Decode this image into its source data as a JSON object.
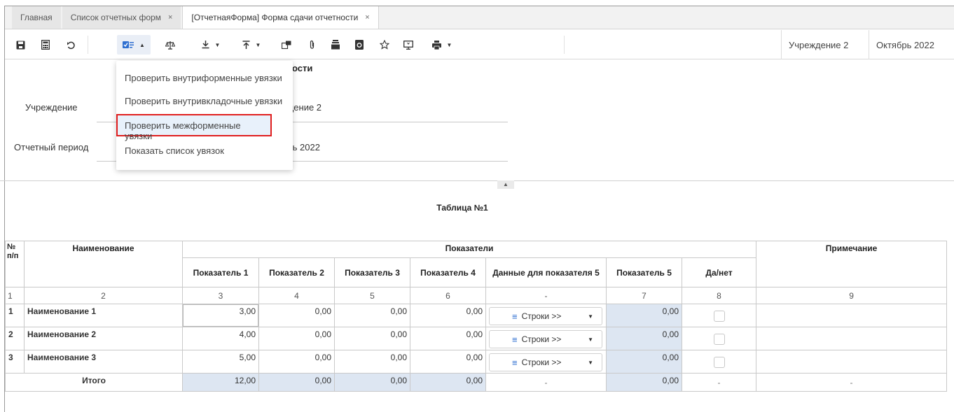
{
  "tabs": [
    {
      "label": "Главная"
    },
    {
      "label": "Список отчетных форм",
      "close": "×"
    },
    {
      "label": "[ОтчетнаяФорма] Форма сдачи отчетности",
      "close": "×"
    }
  ],
  "toolbar": {
    "icons": [
      "save-icon",
      "calculator-icon",
      "undo-icon",
      "check-links-icon",
      "scales-icon",
      "import-icon",
      "export-icon",
      "copy-icon",
      "attachment-icon",
      "archive-icon",
      "refresh-doc-icon",
      "star-icon",
      "monitor-icon",
      "print-icon"
    ],
    "chips": {
      "institution": "Учреждение 2",
      "period": "Октябрь 2022"
    }
  },
  "menu": {
    "items": [
      "Проверить внутриформенные увязки",
      "Проверить внутривкладочные увязки",
      "Проверить межформенные увязки",
      "Показать список увязок"
    ]
  },
  "form": {
    "title_visible": "ости",
    "fields": [
      {
        "label": "Учреждение",
        "value_visible": "ждение 2"
      },
      {
        "label": "Отчетный период",
        "value_visible": "брь 2022"
      }
    ]
  },
  "table": {
    "title": "Таблица №1",
    "headers": {
      "num": "№ п/п",
      "name": "Наименование",
      "indicators": "Показатели",
      "note": "Примечание",
      "sub": [
        "Показатель 1",
        "Показатель 2",
        "Показатель 3",
        "Показатель 4",
        "Данные для показателя 5",
        "Показатель 5",
        "Да/нет"
      ]
    },
    "col_numbers": [
      "1",
      "2",
      "3",
      "4",
      "5",
      "6",
      "-",
      "7",
      "8",
      "9"
    ],
    "rows": [
      {
        "n": "1",
        "name": "Наименование 1",
        "v1": "3,00",
        "v2": "0,00",
        "v3": "0,00",
        "v4": "0,00",
        "rows_btn": "Строки >>",
        "v5": "0,00"
      },
      {
        "n": "2",
        "name": "Наименование 2",
        "v1": "4,00",
        "v2": "0,00",
        "v3": "0,00",
        "v4": "0,00",
        "rows_btn": "Строки >>",
        "v5": "0,00"
      },
      {
        "n": "3",
        "name": "Наименование 3",
        "v1": "5,00",
        "v2": "0,00",
        "v3": "0,00",
        "v4": "0,00",
        "rows_btn": "Строки >>",
        "v5": "0,00"
      }
    ],
    "total": {
      "label": "Итого",
      "v1": "12,00",
      "v2": "0,00",
      "v3": "0,00",
      "v4": "0,00",
      "d": "-",
      "v5": "0,00",
      "yn": "-",
      "note": "-"
    }
  }
}
